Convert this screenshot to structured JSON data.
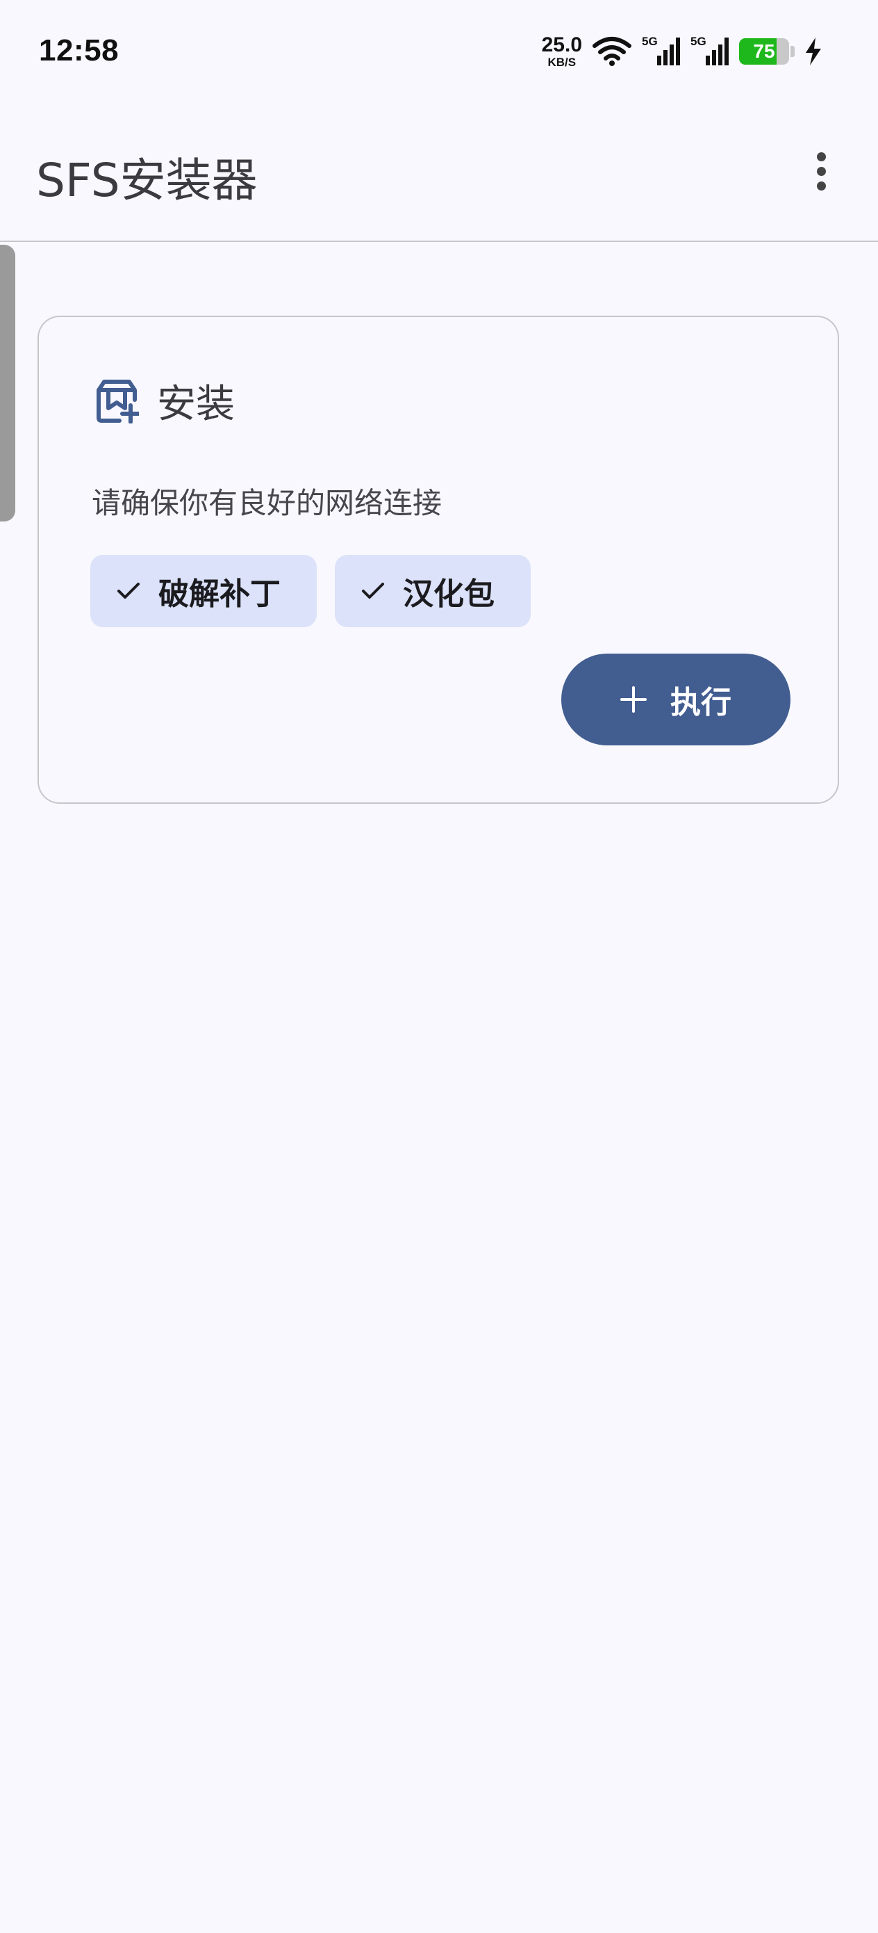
{
  "status_bar": {
    "time": "12:58",
    "net_speed_value": "25.0",
    "net_speed_unit": "KB/S",
    "signal_1_label": "5G",
    "signal_2_label": "5G",
    "battery_level": "75",
    "battery_fraction": 0.75,
    "icons": [
      "wifi-icon",
      "signal-icon",
      "signal-icon",
      "battery-icon",
      "charging-bolt-icon"
    ]
  },
  "app_bar": {
    "title": "SFS安装器",
    "overflow_icon": "more-vert-icon"
  },
  "install_card": {
    "icon": "install-package-icon",
    "title": "安装",
    "description": "请确保你有良好的网络连接",
    "chips": [
      {
        "label": "破解补丁",
        "selected": true,
        "icon": "check-icon"
      },
      {
        "label": "汉化包",
        "selected": true,
        "icon": "check-icon"
      }
    ],
    "action_button": {
      "label": "执行",
      "icon": "plus-icon"
    }
  },
  "colors": {
    "background": "#f9f8fe",
    "chip_selected": "#dbe2f9",
    "primary": "#425e91",
    "outline": "#c7c6ca",
    "battery_green": "#1fb81c"
  }
}
